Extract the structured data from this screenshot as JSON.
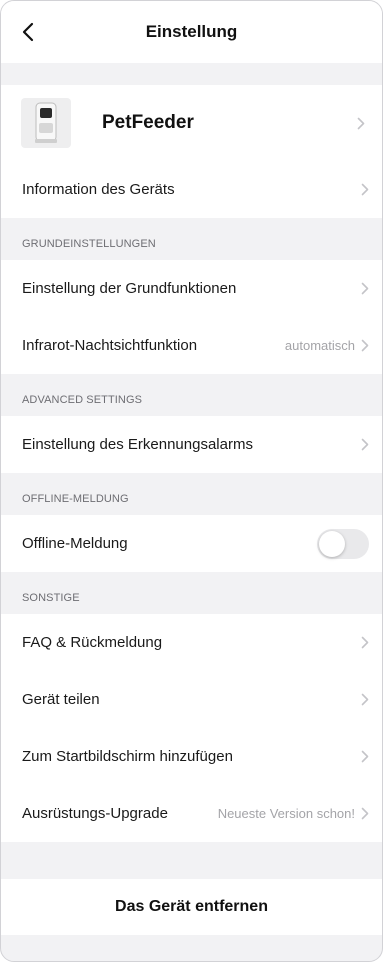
{
  "header": {
    "title": "Einstellung",
    "back_icon": "chevron-left-icon"
  },
  "device": {
    "name": "PetFeeder",
    "thumbnail_icon": "pet-feeder-icon"
  },
  "device_info": {
    "label": "Information des Geräts"
  },
  "sections": {
    "grund": {
      "title": "GRUNDEINSTELLUNGEN",
      "items": [
        {
          "label": "Einstellung der Grundfunktionen",
          "value": ""
        },
        {
          "label": "Infrarot-Nachtsichtfunktion",
          "value": "automatisch"
        }
      ]
    },
    "advanced": {
      "title": "ADVANCED SETTINGS",
      "items": [
        {
          "label": "Einstellung des Erkennungsalarms",
          "value": ""
        }
      ]
    },
    "offline": {
      "title": "OFFLINE-MELDUNG",
      "item": {
        "label": "Offline-Meldung",
        "enabled": false
      }
    },
    "sonstige": {
      "title": "SONSTIGE",
      "items": [
        {
          "label": "FAQ & Rückmeldung",
          "value": ""
        },
        {
          "label": "Gerät teilen",
          "value": ""
        },
        {
          "label": "Zum Startbildschirm hinzufügen",
          "value": ""
        },
        {
          "label": "Ausrüstungs-Upgrade",
          "value": "Neueste Version schon!"
        }
      ]
    }
  },
  "footer": {
    "remove_label": "Das Gerät entfernen"
  },
  "colors": {
    "background": "#f2f2f4",
    "card": "#ffffff",
    "secondary_text": "#a4a4a8",
    "section_text": "#6e6e73",
    "chevron": "#c4c4c8",
    "toggle_off": "#e9e9eb"
  }
}
